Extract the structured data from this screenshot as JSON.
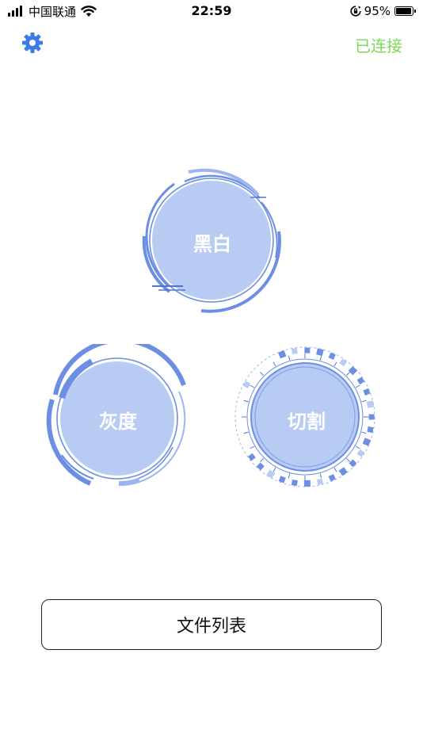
{
  "status_bar": {
    "carrier": "中国联通",
    "time": "22:59",
    "battery_percent": "95%",
    "battery_level": 0.95,
    "icons": [
      "signal-icon",
      "wifi-icon",
      "rotation-lock-icon",
      "battery-icon"
    ]
  },
  "nav": {
    "settings_icon": "gear-icon",
    "connection_status": "已连接"
  },
  "modes": {
    "black_white": "黑白",
    "grayscale": "灰度",
    "cut": "切割"
  },
  "file_list_button": "文件列表",
  "colors": {
    "accent": "#3b7be8",
    "dial_fill": "#b8cbf3",
    "dial_ring": "#6c8fe3",
    "dial_ring_light": "#9db5ef",
    "connected": "#7ed957"
  }
}
